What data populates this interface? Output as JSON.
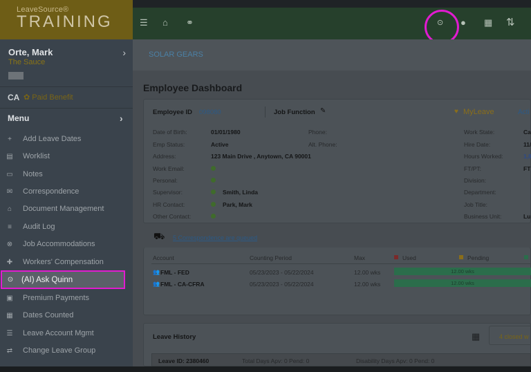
{
  "brand": {
    "small": "LeaveSource®",
    "big": "TRAINING"
  },
  "user": {
    "name": "Orte, Mark",
    "org": "The Sauce",
    "state": "CA",
    "paid": "Paid Benefit"
  },
  "menu": {
    "heading": "Menu",
    "items": [
      {
        "label": "Add Leave Dates",
        "icon": "+"
      },
      {
        "label": "Worklist",
        "icon": "▤"
      },
      {
        "label": "Notes",
        "icon": "▭"
      },
      {
        "label": "Correspondence",
        "icon": "✉"
      },
      {
        "label": "Document Management",
        "icon": "⌂"
      },
      {
        "label": "Audit Log",
        "icon": "≡"
      },
      {
        "label": "Job Accommodations",
        "icon": "⊗"
      },
      {
        "label": "Workers' Compensation",
        "icon": "✚"
      },
      {
        "label": "(AI) Ask Quinn",
        "icon": "⊙"
      },
      {
        "label": "Premium Payments",
        "icon": "▣"
      },
      {
        "label": "Dates Counted",
        "icon": "▦"
      },
      {
        "label": "Leave Account Mgmt",
        "icon": "☰"
      },
      {
        "label": "Change Leave Group",
        "icon": "⇄"
      }
    ]
  },
  "breadcrumb": "SOLAR GEARS",
  "page_title": "Employee Dashboard",
  "employee": {
    "id_label": "Employee ID",
    "id": "098080",
    "job_function": "Job Function",
    "myleave": "MyLeave",
    "active": "Acti",
    "left": [
      {
        "k": "Date of Birth:",
        "v": "01/01/1980"
      },
      {
        "k": "Emp Status:",
        "v": "Active"
      },
      {
        "k": "Address:",
        "v": "123 Main Drive , Anytown, CA 90001"
      },
      {
        "k": "Work Email:",
        "v": ""
      },
      {
        "k": "Personal:",
        "v": ""
      },
      {
        "k": "Supervisor:",
        "v": "Smith, Linda"
      },
      {
        "k": "HR Contact:",
        "v": "Park, Mark"
      },
      {
        "k": "Other Contact:",
        "v": ""
      }
    ],
    "middle": [
      {
        "k": "Phone:"
      },
      {
        "k": "Alt. Phone:"
      }
    ],
    "right": [
      {
        "k": "Work State:",
        "v": "Cal"
      },
      {
        "k": "Hire Date:",
        "v": "11/"
      },
      {
        "k": "Hours Worked:",
        "v": "1,8"
      },
      {
        "k": "FT/PT:",
        "v": "FT"
      },
      {
        "k": "Division:",
        "v": ""
      },
      {
        "k": "Department:",
        "v": ""
      },
      {
        "k": "Job Title:",
        "v": ""
      },
      {
        "k": "Business Unit:",
        "v": "Lu"
      }
    ]
  },
  "queue": {
    "text": "5 Correspondence are queued"
  },
  "table": {
    "headers": [
      "Account",
      "Counting Period",
      "Max",
      "Used",
      "Pending"
    ],
    "rows": [
      {
        "account": "FML - FED",
        "period": "05/23/2023 - 05/22/2024",
        "max": "12.00 wks",
        "bar": "12.00 wks"
      },
      {
        "account": "FML - CA-CFRA",
        "period": "05/23/2023 - 05/22/2024",
        "max": "12.00 wks",
        "bar": "12.00 wks"
      }
    ]
  },
  "history": {
    "title": "Leave History",
    "closed": "4 closed w",
    "leave_id": "Leave ID: 2380460",
    "total": "Total Days Apv: 0 Pend: 0",
    "disability": "Disability Days Apv: 0 Pend: 0"
  }
}
